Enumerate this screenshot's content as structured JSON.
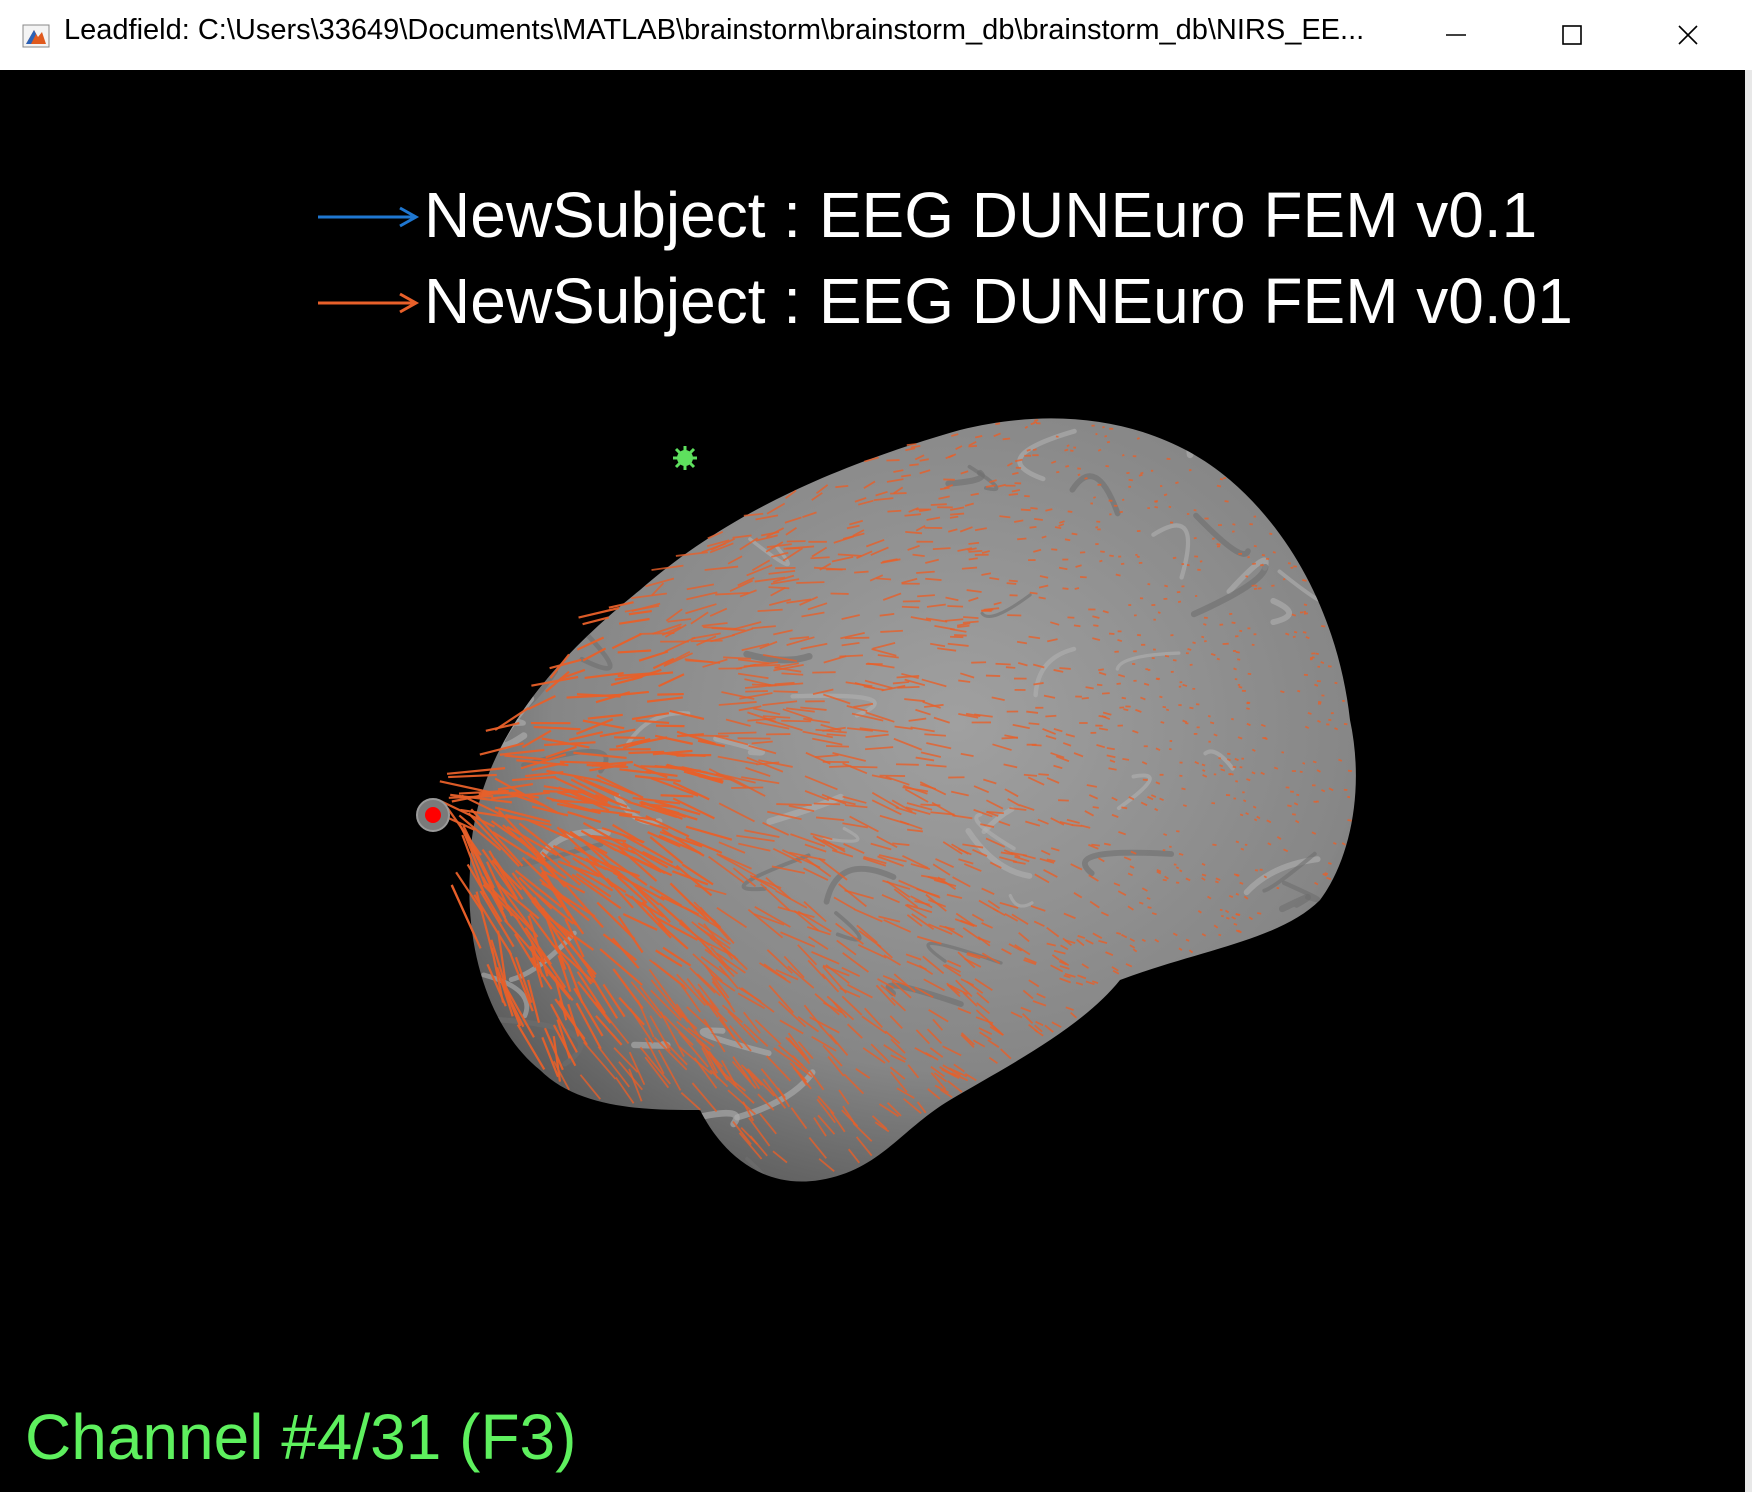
{
  "window": {
    "title": "Leadfield: C:\\Users\\33649\\Documents\\MATLAB\\brainstorm\\brainstorm_db\\brainstorm_db\\NIRS_EE...",
    "app_icon": "matlab-figure-icon",
    "controls": {
      "minimize": "minimize-icon",
      "maximize": "maximize-icon",
      "close": "close-icon"
    }
  },
  "legend": [
    {
      "label": "NewSubject : EEG DUNEuro FEM v0.1",
      "color": "#1f77d0"
    },
    {
      "label": "NewSubject : EEG DUNEuro FEM v0.01",
      "color": "#e8602a"
    }
  ],
  "channel": {
    "label": "Channel #4/31  (F3)",
    "color": "#5ef05e"
  },
  "colors": {
    "background": "#000000",
    "brain_surface": "#8a8a8a",
    "vectors": "#e8602a",
    "electrode_selected": "#ff0000",
    "reference_marker": "#5ee05e"
  }
}
